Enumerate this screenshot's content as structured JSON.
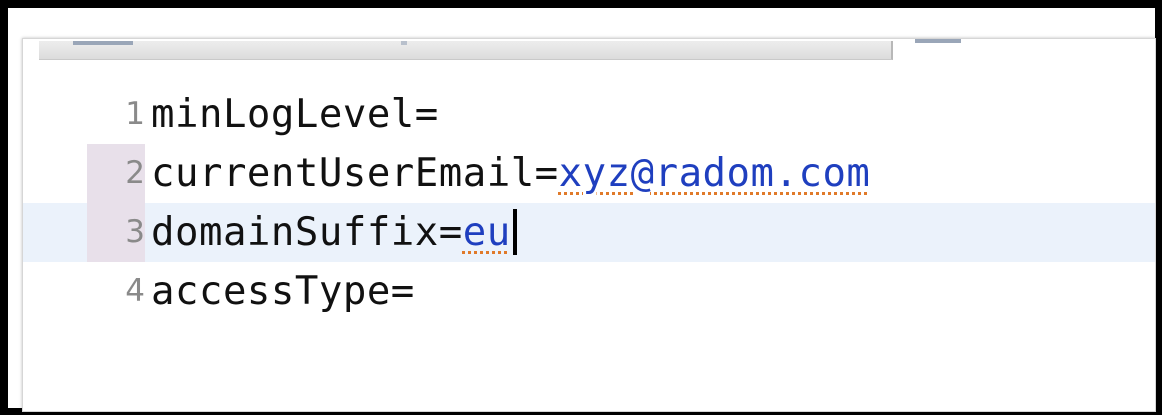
{
  "editor": {
    "lines": [
      {
        "number": "1",
        "key": "minLogLevel=",
        "value": ""
      },
      {
        "number": "2",
        "key": "currentUserEmail=",
        "value": "xyz@radom.com"
      },
      {
        "number": "3",
        "key": "domainSuffix=",
        "value": "eu"
      },
      {
        "number": "4",
        "key": "accessType=",
        "value": ""
      }
    ],
    "current_line": 3,
    "spellcheck_underline_color": "#e07a2a",
    "value_color": "#1f3fbf",
    "current_line_color": "#ebf2fb"
  }
}
